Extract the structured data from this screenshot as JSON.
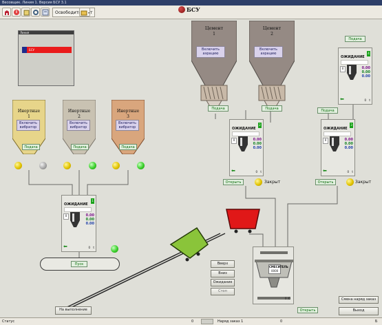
{
  "window": {
    "title": "Весовщик. Линия 1. Версия БСУ 3.1"
  },
  "toolbar": {
    "release_port_label": "Освободить порт",
    "icons": [
      "plant-icon",
      "alarm-icon",
      "edit-icon",
      "settings-icon",
      "gauge-icon",
      "folder-icon"
    ]
  },
  "brand": {
    "logo_text": "БСУ"
  },
  "left_panel": {
    "header": "Линия",
    "item": "БСУ"
  },
  "inert_silos": [
    {
      "label_line1": "Инертные",
      "label_line2": "1",
      "vibrator": "Включить вибратор",
      "feed": "Подача",
      "lamps": [
        "yellow",
        "grey"
      ]
    },
    {
      "label_line1": "Инертные",
      "label_line2": "2",
      "vibrator": "Включить вибратор",
      "feed": "Подача",
      "lamps": [
        "yellow",
        "green"
      ]
    },
    {
      "label_line1": "Инертные",
      "label_line2": "3",
      "vibrator": "Включить вибратор",
      "feed": "Подача",
      "lamps": [
        "yellow",
        "green"
      ]
    }
  ],
  "cement_silos": [
    {
      "label_line1": "Цемент",
      "label_line2": "1",
      "aeration": "Включить аэрацию",
      "feed": "Подача"
    },
    {
      "label_line1": "Цемент",
      "label_line2": "2",
      "aeration": "Включить аэрацию",
      "feed": "Подача"
    }
  ],
  "right_feed": {
    "feed1": "Подача",
    "feed2": "Подача"
  },
  "dosers": {
    "inert": {
      "status": "ОЖИДАНИЕ",
      "num": "1",
      "zero": "0",
      "v1": "0.00",
      "v2": "0.00",
      "v3": "0.00",
      "z": "0",
      "t": "t"
    },
    "cement": {
      "status": "ОЖИДАНИЕ",
      "num": "2",
      "zero": "0",
      "v1": "0.00",
      "v2": "0.00",
      "v3": "0.00",
      "z": "0",
      "t": "t",
      "open": "Открыть",
      "closed": "Закрыт"
    },
    "water": {
      "status": "ОЖИДАНИЕ",
      "num": "3",
      "zero": "0",
      "v1": "0.00",
      "v2": "0.00",
      "v3": "0.00",
      "z": "0",
      "t": "t",
      "open": "Открыть",
      "closed": "Закрыт"
    },
    "additive": {
      "status": "ОЖИДАНИЕ",
      "num": "4",
      "zero": "0",
      "v1": "0.00",
      "v2": "0.00",
      "v3": "0.00",
      "z": "0",
      "t": "t"
    }
  },
  "conveyor": {
    "start": "Пуск"
  },
  "skip_controls": {
    "up": "Вверх",
    "down": "Вниз",
    "wait": "Ожидание",
    "stop": "Стоп"
  },
  "mixer": {
    "label": "СМЕСИТЕЛЬ",
    "value": "0000",
    "ratio": "0 /0",
    "open": "Открыть"
  },
  "buttons": {
    "to_execute": "На выполнение",
    "change_order": "Смена наряд заказ",
    "exit": "Выход"
  },
  "statusbar": {
    "status_label": "Статус",
    "count_a": "0",
    "order_label": "Наряд заказ 1",
    "count_b": "0",
    "end": "Б"
  }
}
